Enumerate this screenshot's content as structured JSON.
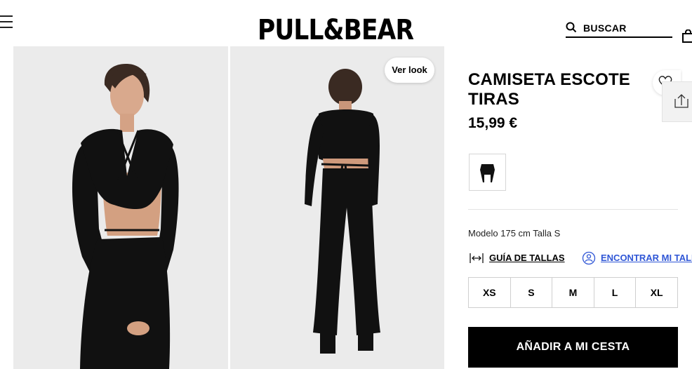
{
  "header": {
    "logo": "PULL&BEAR",
    "search_label": "BUSCAR"
  },
  "gallery": {
    "ver_look_label": "Ver look"
  },
  "product": {
    "title": "CAMISETA ESCOTE TIRAS",
    "price": "15,99 €",
    "model_info": "Modelo 175 cm Talla S",
    "size_guide_label": "GUÍA DE TALLAS",
    "find_size_label": "ENCONTRAR MI TALLA",
    "sizes": [
      "XS",
      "S",
      "M",
      "L",
      "XL"
    ],
    "add_to_cart_label": "AÑADIR A MI CESTA"
  },
  "colors": {
    "accent_link": "#2f56d6",
    "button_bg": "#000000"
  },
  "icons": [
    "menu-icon",
    "search-icon",
    "bag-icon",
    "heart-icon",
    "share-icon",
    "ruler-icon",
    "user-size-icon"
  ]
}
